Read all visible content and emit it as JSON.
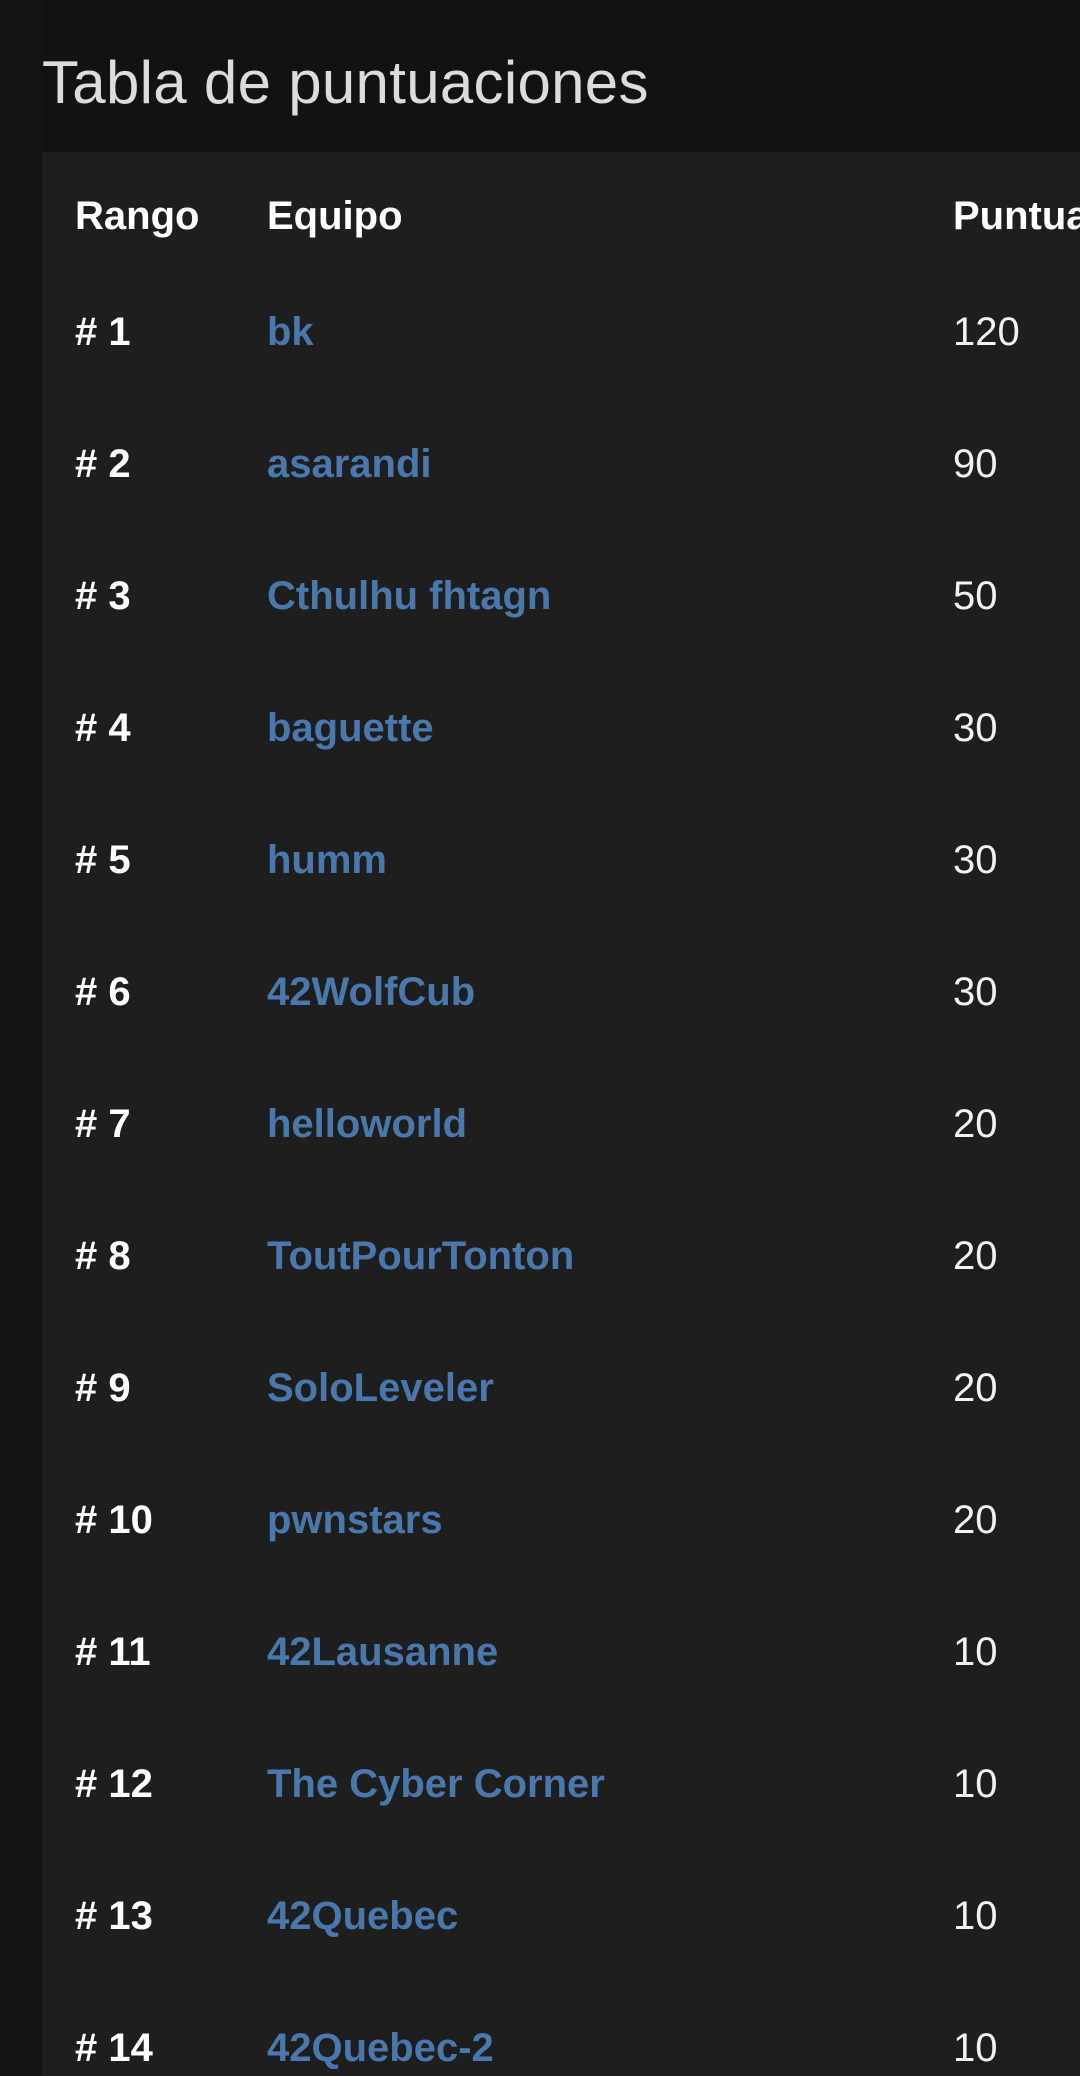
{
  "page": {
    "title": "Tabla de puntuaciones"
  },
  "table": {
    "headers": {
      "rank": "Rango",
      "team": "Equipo",
      "score": "Puntua"
    },
    "rows": [
      {
        "rank": "# 1",
        "team": "bk",
        "score": "120"
      },
      {
        "rank": "# 2",
        "team": "asarandi",
        "score": "90"
      },
      {
        "rank": "# 3",
        "team": "Cthulhu fhtagn",
        "score": "50"
      },
      {
        "rank": "# 4",
        "team": "baguette",
        "score": "30"
      },
      {
        "rank": "# 5",
        "team": "humm",
        "score": "30"
      },
      {
        "rank": "# 6",
        "team": "42WolfCub",
        "score": "30"
      },
      {
        "rank": "# 7",
        "team": "helloworld",
        "score": "20"
      },
      {
        "rank": "# 8",
        "team": "ToutPourTonton",
        "score": "20"
      },
      {
        "rank": "# 9",
        "team": "SoloLeveler",
        "score": "20"
      },
      {
        "rank": "# 10",
        "team": "pwnstars",
        "score": "20"
      },
      {
        "rank": "# 11",
        "team": "42Lausanne",
        "score": "10"
      },
      {
        "rank": "# 12",
        "team": "The Cyber Corner",
        "score": "10"
      },
      {
        "rank": "# 13",
        "team": "42Quebec",
        "score": "10"
      },
      {
        "rank": "# 14",
        "team": "42Quebec-2",
        "score": "10"
      }
    ]
  },
  "colors": {
    "background": "#121212",
    "panel": "#1e1e1e",
    "link": "#4a78ad",
    "text": "#ffffff"
  }
}
